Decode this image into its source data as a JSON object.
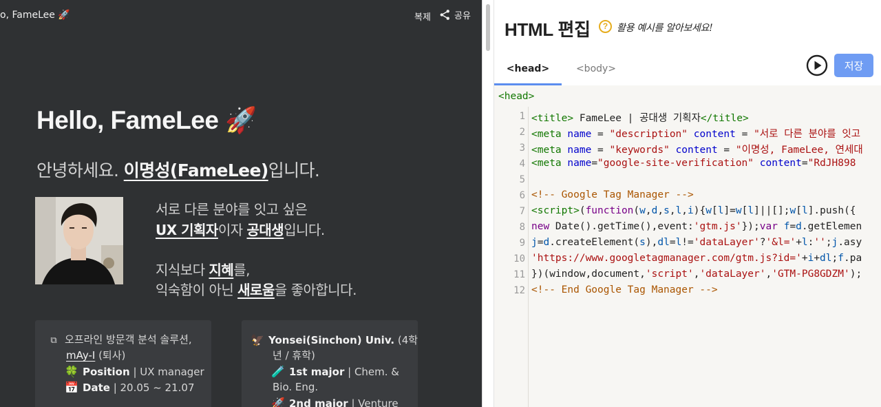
{
  "preview": {
    "tab_title": "o, FameLee 🚀",
    "copy_label": "복제",
    "share_label": "공유",
    "hero_title": "Hello, FameLee 🚀",
    "greet_prefix": "안녕하세요. ",
    "greet_name": "이명성(FameLee)",
    "greet_suffix": "입니다.",
    "intro": {
      "line1": "서로 다른 분야를 잇고 싶은",
      "line2_b1": "UX 기획자",
      "line2_t1": "이자 ",
      "line2_b2": "공대생",
      "line2_t2": "입니다.",
      "line3_t1": "지식보다 ",
      "line3_b1": "지혜",
      "line3_t2": "를,",
      "line4_t1": "익숙함이 아닌 ",
      "line4_b1": "새로움",
      "line4_t2": "을 좋아합니다."
    },
    "card1": {
      "icon1": "⧉",
      "line1": "오프라인 방문객 분석 솔루션,",
      "company": "mAy-I",
      "company_suffix": " (퇴사)",
      "icon2": "🍀",
      "position_label": "Position",
      "position_value": " | UX manager",
      "icon3": "📅",
      "date_label": "Date",
      "date_value": " | 20.05 ~ 21.07"
    },
    "card2": {
      "icon1": "🦅",
      "school": "Yonsei(Sinchon) Univ.",
      "school_suffix": " (4학",
      "line2": "년 / 휴학)",
      "icon2": "🧪",
      "major1_label": "1st major",
      "major1_value": " | Chem. &",
      "line4": "Bio. Eng.",
      "icon3": "🚀",
      "major2_label": "2nd major",
      "major2_value": " | Venture"
    }
  },
  "editor": {
    "title": "HTML 편집",
    "hint": "활용 예시를 알아보세요!",
    "tabs": [
      {
        "label": "<head>"
      },
      {
        "label": "<body>"
      }
    ],
    "save_label": "저장",
    "code_header": "<head>",
    "line_numbers": [
      "1",
      "2",
      "3",
      "4",
      "5",
      "6",
      "7",
      "8",
      "9",
      "10",
      "11",
      "12"
    ]
  },
  "colors": {
    "preview_bg": "#2f3133",
    "accent_blue": "#6f9cf3",
    "tab_underline": "#5b8def",
    "help_yellow": "#e6ad1e"
  }
}
